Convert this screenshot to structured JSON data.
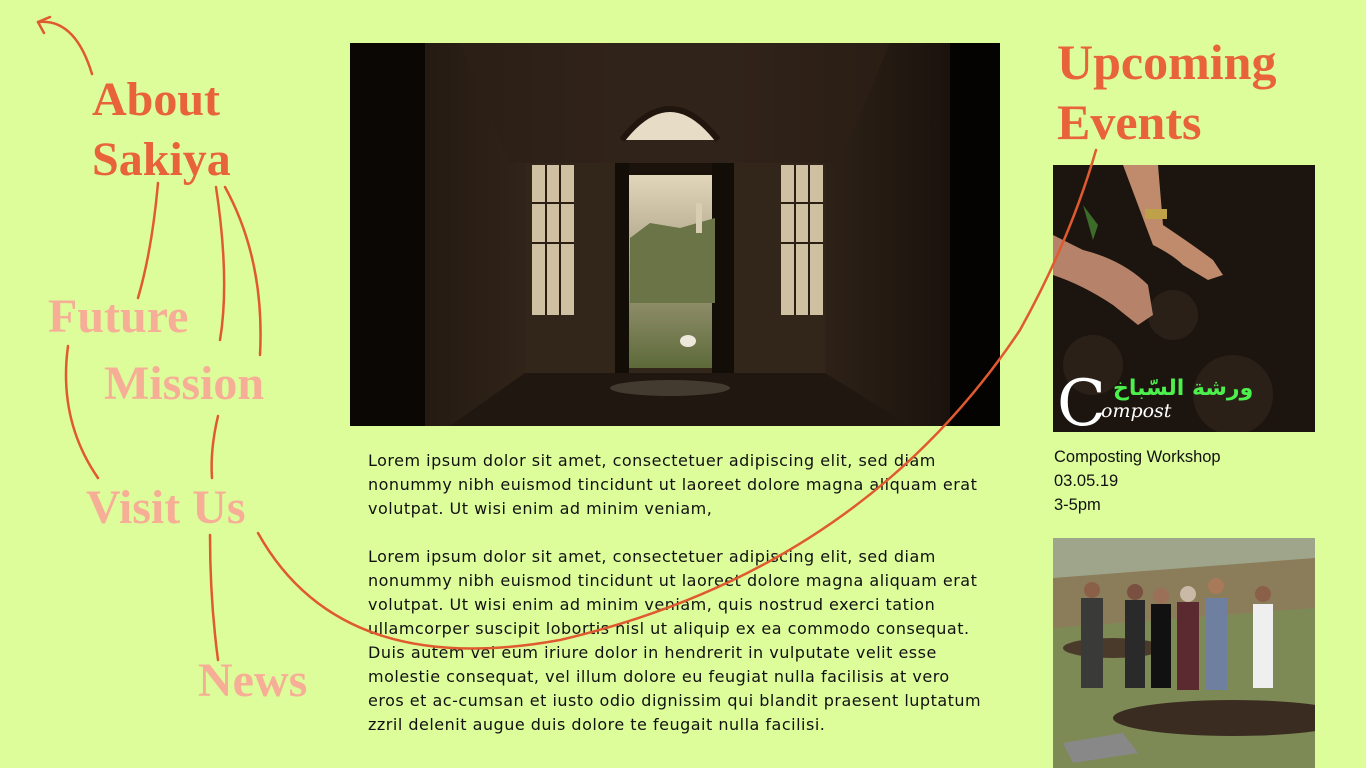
{
  "nav": {
    "about": "About Sakiya",
    "future": "Future",
    "mission": "Mission",
    "visit": "Visit Us",
    "news": "News"
  },
  "main": {
    "paragraphs": [
      "Lorem ipsum dolor sit amet, consectetuer adipiscing elit, sed diam nonummy nibh euismod tincidunt ut laoreet dolore magna aliquam erat volutpat. Ut wisi enim ad minim veniam,",
      "Lorem ipsum dolor sit amet, consectetuer adipiscing elit, sed diam nonummy nibh euismod tincidunt ut laoreet dolore magna aliquam erat volutpat. Ut wisi enim ad minim veniam, quis nostrud exerci tation ullamcorper suscipit lobortis nisl ut aliquip ex ea commodo consequat. Duis autem vel eum iriure dolor in hendrerit in vulputate velit esse molestie consequat, vel illum dolore eu feugiat nulla facilisis at vero eros et ac-cumsan et iusto odio dignissim qui blandit praesent luptatum zzril delenit augue duis dolore te feugait nulla facilisi."
    ]
  },
  "events": {
    "title": "Upcoming Events",
    "items": [
      {
        "overlay_arabic": "ورشة السّباخ",
        "overlay_latin": "ompost",
        "overlay_initial": "C",
        "name": "Composting Workshop",
        "date": "03.05.19",
        "time": "3-5pm"
      },
      {}
    ]
  },
  "colors": {
    "background": "#ddfd9a",
    "accent": "#e8623a",
    "nav_dim": "#f6ae96"
  }
}
